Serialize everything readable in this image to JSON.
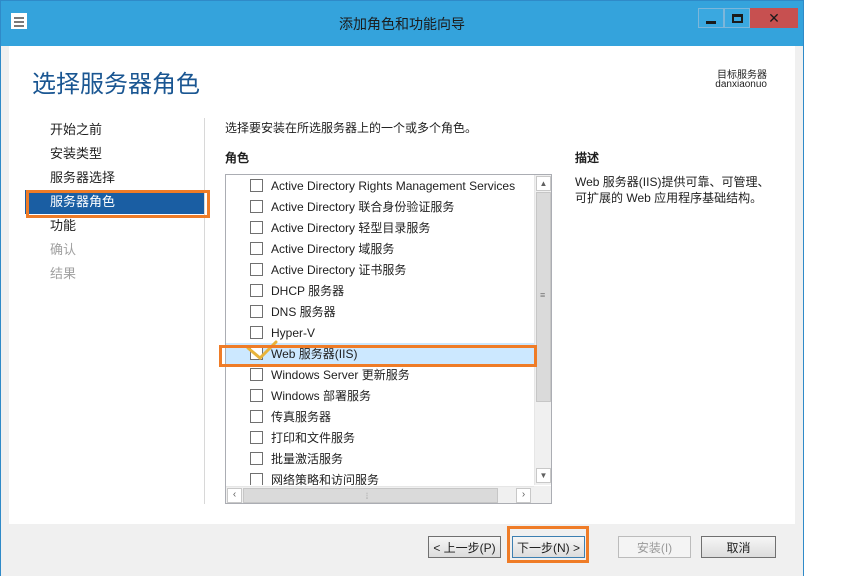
{
  "window": {
    "title": "添加角色和功能向导",
    "controls": {
      "minimize": "minimize",
      "maximize": "maximize",
      "close": "close"
    }
  },
  "header": {
    "page_title": "选择服务器角色",
    "target_label": "目标服务器",
    "target_server": "danxiaonuo"
  },
  "nav": {
    "items": [
      {
        "label": "开始之前",
        "state": "normal"
      },
      {
        "label": "安装类型",
        "state": "normal"
      },
      {
        "label": "服务器选择",
        "state": "normal"
      },
      {
        "label": "服务器角色",
        "state": "active"
      },
      {
        "label": "功能",
        "state": "normal"
      },
      {
        "label": "确认",
        "state": "disabled"
      },
      {
        "label": "结果",
        "state": "disabled"
      }
    ]
  },
  "main": {
    "instruction": "选择要安装在所选服务器上的一个或多个角色。",
    "roles_label": "角色",
    "roles": [
      {
        "label": "Active Directory Rights Management Services",
        "checked": false
      },
      {
        "label": "Active Directory 联合身份验证服务",
        "checked": false
      },
      {
        "label": "Active Directory 轻型目录服务",
        "checked": false
      },
      {
        "label": "Active Directory 域服务",
        "checked": false
      },
      {
        "label": "Active Directory 证书服务",
        "checked": false
      },
      {
        "label": "DHCP 服务器",
        "checked": false
      },
      {
        "label": "DNS 服务器",
        "checked": false
      },
      {
        "label": "Hyper-V",
        "checked": false
      },
      {
        "label": "Web 服务器(IIS)",
        "checked": true,
        "selected": true
      },
      {
        "label": "Windows Server 更新服务",
        "checked": false
      },
      {
        "label": "Windows 部署服务",
        "checked": false
      },
      {
        "label": "传真服务器",
        "checked": false
      },
      {
        "label": "打印和文件服务",
        "checked": false
      },
      {
        "label": "批量激活服务",
        "checked": false
      },
      {
        "label": "网络策略和访问服务",
        "checked": false
      }
    ]
  },
  "description": {
    "label": "描述",
    "text": "Web 服务器(IIS)提供可靠、可管理、可扩展的 Web 应用程序基础结构。"
  },
  "footer": {
    "prev": "< 上一步(P)",
    "next": "下一步(N) >",
    "install": "安装(I)",
    "cancel": "取消"
  },
  "colors": {
    "accent": "#1a5ea3",
    "title_bar": "#34a3dc",
    "annotation": "#ef7c27",
    "checkmark": "#e8b33a"
  }
}
